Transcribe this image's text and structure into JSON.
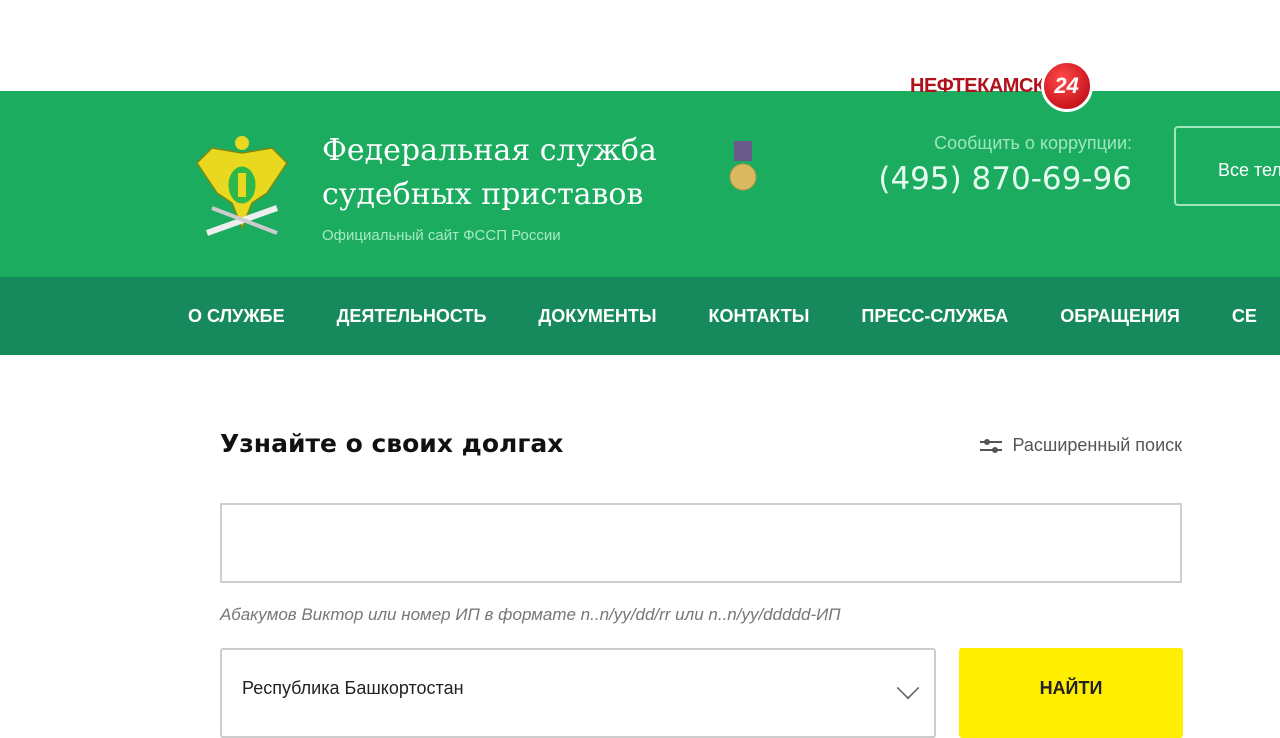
{
  "overlay": {
    "channel_name": "НЕФТЕКАМСК",
    "channel_number": "24"
  },
  "header": {
    "title_line1": "Федеральная служба",
    "title_line2": "судебных приставов",
    "subtitle": "Официальный сайт ФССП России",
    "corruption_label": "Сообщить о коррупции:",
    "corruption_phone": "(495) 870-69-96",
    "all_phones_button": "Все тел"
  },
  "nav": {
    "items": [
      "О СЛУЖБЕ",
      "ДЕЯТЕЛЬНОСТЬ",
      "ДОКУМЕНТЫ",
      "КОНТАКТЫ",
      "ПРЕСС-СЛУЖБА",
      "ОБРАЩЕНИЯ",
      "СЕ"
    ]
  },
  "search": {
    "heading": "Узнайте о своих долгах",
    "advanced_link": "Расширенный поиск",
    "input_value": "",
    "hint": "Абакумов Виктор или номер ИП в формате n..n/yy/dd/rr или n..n/yy/ddddd-ИП",
    "region_selected": "Республика Башкортостан",
    "find_button": "НАЙТИ"
  },
  "colors": {
    "header_green": "#1cac60",
    "nav_green": "#168a5d",
    "find_yellow": "#ffee00"
  }
}
